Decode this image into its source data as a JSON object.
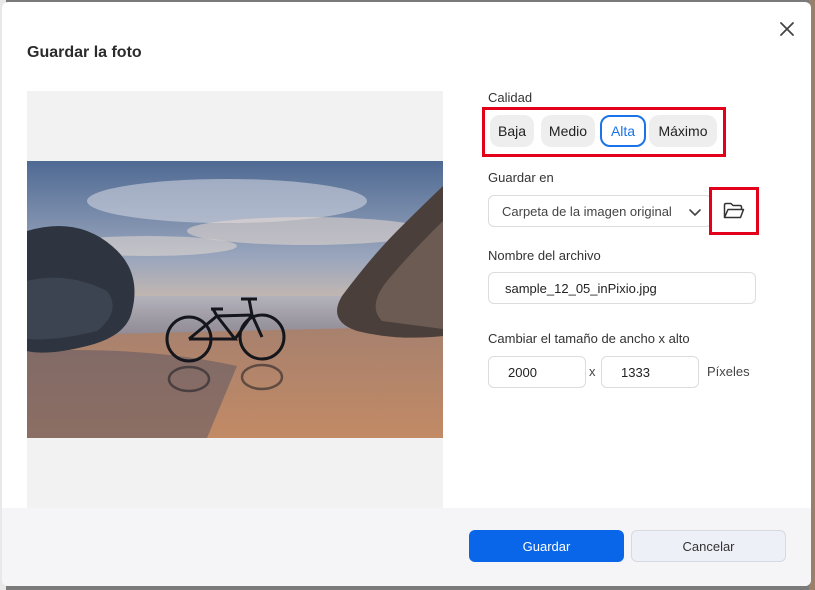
{
  "dialog": {
    "title": "Guardar la foto",
    "close_icon": "close-icon"
  },
  "quality": {
    "label": "Calidad",
    "options": [
      "Baja",
      "Medio",
      "Alta",
      "Máximo"
    ],
    "selected": "Alta"
  },
  "save_location": {
    "label": "Guardar en",
    "value": "Carpeta de la imagen original",
    "folder_icon": "folder-open-icon"
  },
  "file_name": {
    "label": "Nombre del archivo",
    "value": "sample_12_05_inPixio.jpg"
  },
  "resize": {
    "label": "Cambiar el tamaño de ancho x alto",
    "width": "2000",
    "separator": "x",
    "height": "1333",
    "unit": "Píxeles"
  },
  "actions": {
    "save": "Guardar",
    "cancel": "Cancelar"
  },
  "colors": {
    "primary": "#0a66e8",
    "highlight_frame": "#e3001b",
    "selected_outline": "#1a73e8"
  }
}
